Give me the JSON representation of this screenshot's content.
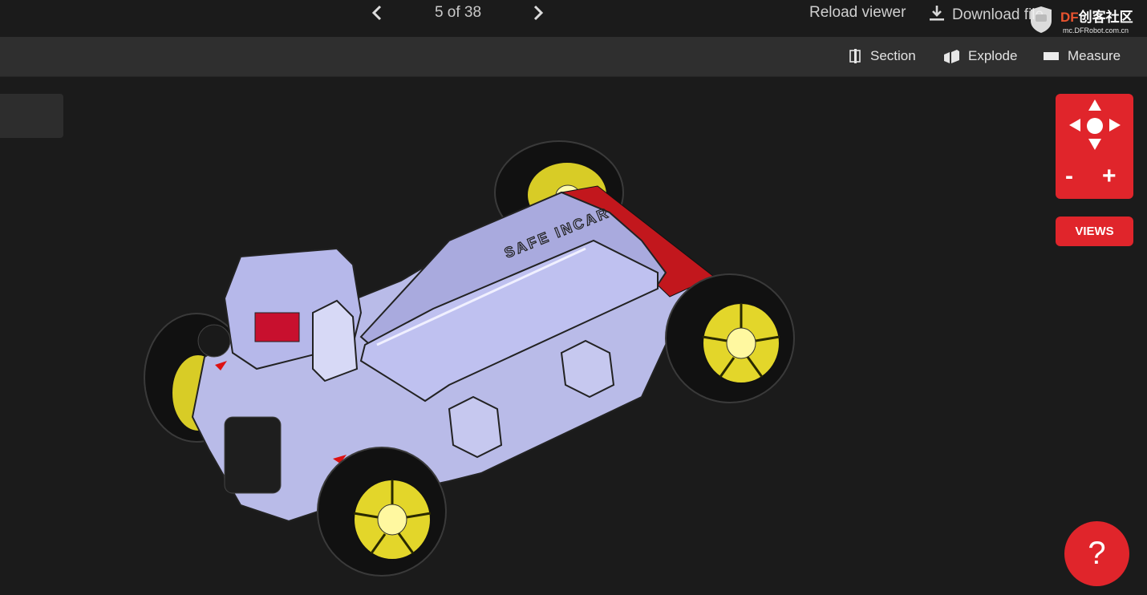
{
  "pager": {
    "label": "5 of 38",
    "current": 5,
    "total": 38
  },
  "header": {
    "reload_label": "Reload viewer",
    "download_label": "Download file"
  },
  "watermark": {
    "brand_prefix": "DF",
    "brand_cn": "创客社区",
    "url": "mc.DFRobot.com.cn"
  },
  "toolbar": {
    "section_label": "Section",
    "explode_label": "Explode",
    "measure_label": "Measure"
  },
  "navpad": {
    "zoom_out": "-",
    "zoom_in": "+"
  },
  "views_label": "VIEWS",
  "help_label": "?",
  "model": {
    "engraving": "SAFE INCAR"
  },
  "colors": {
    "accent": "#e0252b",
    "background": "#1b1b1b",
    "toolbar": "#2f2f2f",
    "wheel_hub": "#e3d62a",
    "body": "#b9bbe8"
  }
}
